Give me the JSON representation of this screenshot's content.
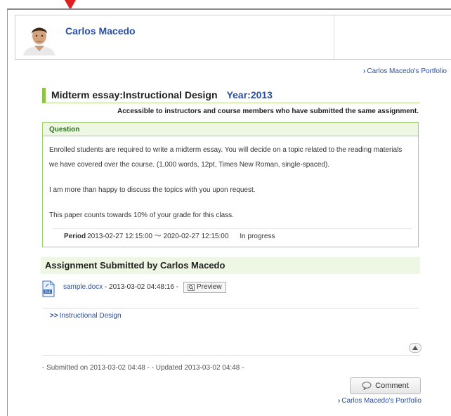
{
  "profile": {
    "name": "Carlos Macedo",
    "avatar_icon": "user-photo"
  },
  "portfolio_link_top": "Carlos Macedo's Portfolio",
  "assignment": {
    "title": "Midterm essay:Instructional Design",
    "year": "Year:2013",
    "access_note": "Accessible to instructors and course members who have submitted the same assignment."
  },
  "question": {
    "header": "Question",
    "para1": "Enrolled students are required to write a midterm essay. You will decide on a topic related to the reading materials we have covered over the course. (1,000 words, 12pt, Times New Roman, single-spaced).",
    "para2": "I am more than happy to discuss the topics with you upon request.",
    "para3": "This paper counts towards 10% of your grade for this class.",
    "period_label": "Period",
    "period_value": "2013-02-27 12:15:00 ～ 2020-02-27 12:15:00",
    "status": "In progress"
  },
  "submission": {
    "heading": "Assignment Submitted by Carlos Macedo",
    "file_name": "sample.docx",
    "file_meta": " - 2013-03-02 04:48:16 - ",
    "preview_label": "Preview",
    "course_link": "Instructional Design",
    "course_link_prefix": ">>",
    "info": "- Submitted on 2013-03-02 04:48 - - Updated 2013-03-02 04:48 -"
  },
  "actions": {
    "comment_label": "Comment",
    "portfolio_link_bottom": "Carlos Macedo's Portfolio"
  },
  "colors": {
    "accent_blue": "#2a4fa3",
    "accent_green": "#8cc63f",
    "highlight_bg": "#eef7e3",
    "arrow_red": "#e02020"
  }
}
